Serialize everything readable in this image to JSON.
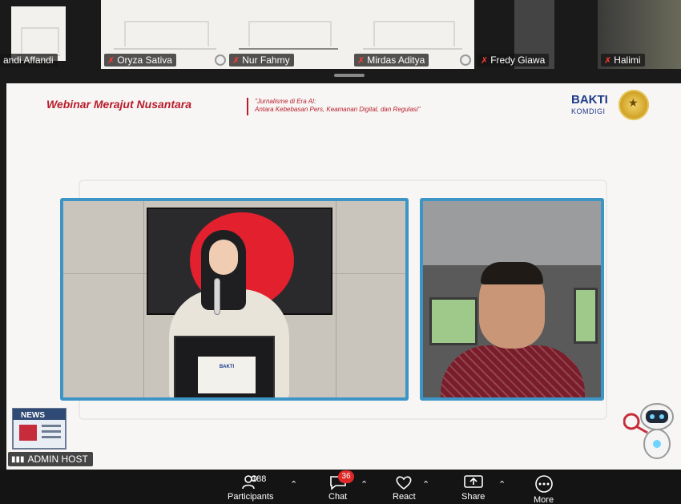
{
  "gallery": {
    "tiles": [
      {
        "name": "andi Affandi",
        "kind": "slide",
        "muted": false
      },
      {
        "name": "Oryza Sativa",
        "kind": "slide",
        "muted": true
      },
      {
        "name": "Nur Fahmy",
        "kind": "slide",
        "muted": true
      },
      {
        "name": "Mirdas Aditya",
        "kind": "slide",
        "muted": true
      },
      {
        "name": "Fredy Giawa",
        "kind": "camera",
        "muted": true
      },
      {
        "name": "Halimi",
        "kind": "camera",
        "muted": true
      }
    ]
  },
  "slide": {
    "webinar_title": "Webinar Merajut Nusantara",
    "subtitle_line1": "\"Jurnalisme di Era AI:",
    "subtitle_line2": "Antara Kebebasan Pers, Keamanan Digital, dan Regulasi\"",
    "logo_text": "BAKTI",
    "logo_sub": "KOMDIGI",
    "podium_label": "BAKTI"
  },
  "host_tag": {
    "label": "ADMIN HOST"
  },
  "toolbar": {
    "participants": {
      "label": "Participants",
      "count": "188"
    },
    "chat": {
      "label": "Chat",
      "badge": "36"
    },
    "react": {
      "label": "React"
    },
    "share": {
      "label": "Share"
    },
    "more": {
      "label": "More"
    }
  },
  "colors": {
    "accent_red": "#b91c2c",
    "frame_blue": "#3d95c6",
    "toolbar_bg": "#141414"
  }
}
